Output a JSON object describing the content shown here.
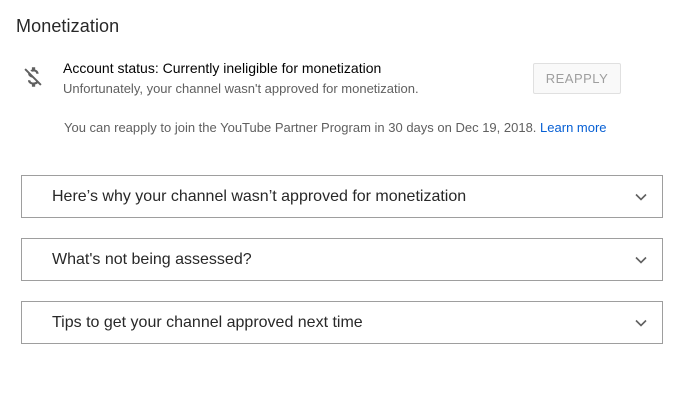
{
  "header": {
    "title": "Monetization"
  },
  "status": {
    "icon": "money-off-icon",
    "heading": "Account status: Currently ineligible for monetization",
    "subtext": "Unfortunately, your channel wasn't approved for monetization.",
    "reapply_label": "REAPPLY"
  },
  "reapply_note": {
    "text": "You can reapply to join the YouTube Partner Program in 30 days on Dec 19, 2018.",
    "link_label": "Learn more",
    "link_color": "#065fd4"
  },
  "panels": [
    {
      "label": "Here’s why your channel wasn’t approved for monetization",
      "icon": "chevron-down-icon"
    },
    {
      "label": "What's not being assessed?",
      "icon": "chevron-down-icon"
    },
    {
      "label": "Tips to get your channel approved next time",
      "icon": "chevron-down-icon"
    }
  ]
}
